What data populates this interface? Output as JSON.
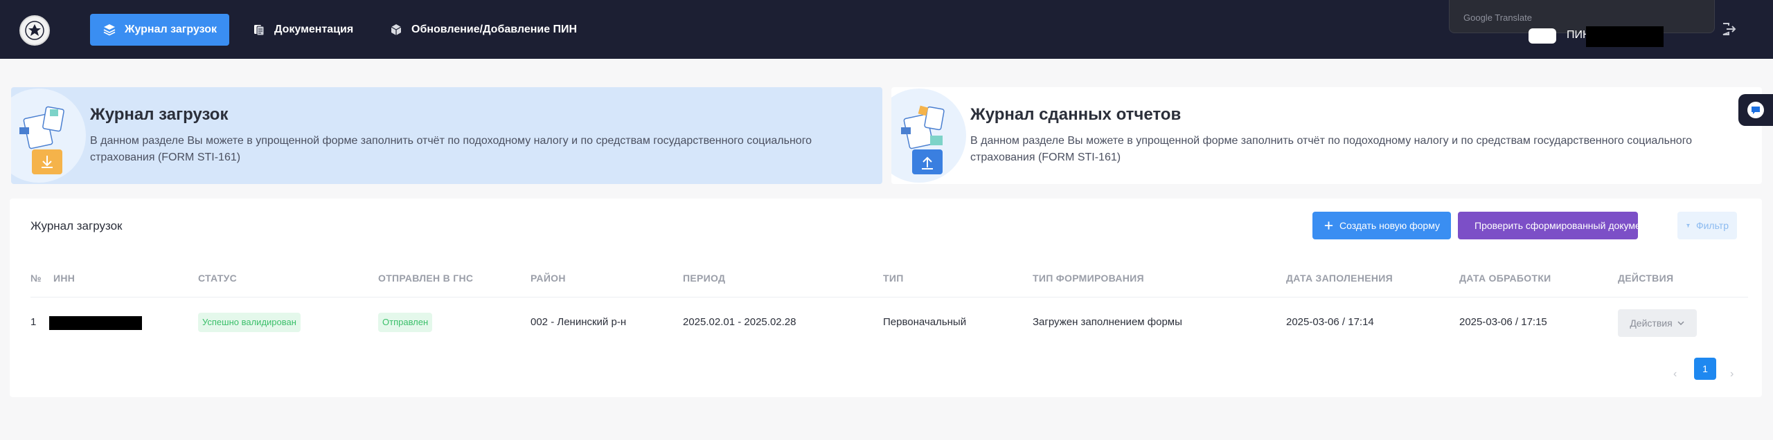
{
  "header": {
    "logo_alt": "state-emblem",
    "nav": [
      {
        "label": "Журнал загрузок",
        "icon": "layers-icon",
        "active": true
      },
      {
        "label": "Документация",
        "icon": "documents-icon",
        "active": false
      },
      {
        "label": "Обновление/Добавление ПИН",
        "icon": "cube-icon",
        "active": false
      }
    ],
    "translate_popup": "Google Translate",
    "pin_label": "ПИН:"
  },
  "hero_cards": [
    {
      "title": "Журнал загрузок",
      "text": "В данном разделе Вы можете в упрощенной форме заполнить отчёт по подоходному налогу и по средствам государственного социального страхования (FORM STI-161)",
      "icon": "download-folder-icon"
    },
    {
      "title": "Журнал сданных отчетов",
      "text": "В данном разделе Вы можете в упрощенной форме заполнить отчёт по подоходному налогу и по средствам государственного социального страхования (FORM STI-161)",
      "icon": "upload-folder-icon"
    }
  ],
  "panel": {
    "title": "Журнал загрузок",
    "buttons": {
      "create": "Создать новую форму",
      "check": "Проверить сформированный документ",
      "filter": "Фильтр"
    },
    "columns": [
      "№",
      "ИНН",
      "СТАТУС",
      "ОТПРАВЛЕН В ГНС",
      "РАЙОН",
      "ПЕРИОД",
      "ТИП",
      "ТИП ФОРМИРОВАНИЯ",
      "ДАТА ЗАПОЛЕНЕНИЯ",
      "ДАТА ОБРАБОТКИ",
      "ДЕЙСТВИЯ"
    ],
    "rows": [
      {
        "num": "1",
        "status": "Успешно валидирован",
        "sent": "Отправлен",
        "district": "002 - Ленинский р-н",
        "period": "2025.02.01 - 2025.02.28",
        "type": "Первоначальный",
        "formation": "Загружен заполнением формы",
        "filled_date": "2025-03-06 / 17:14",
        "processed_date": "2025-03-06 / 17:15",
        "actions": "Действия"
      }
    ],
    "pagination": {
      "prev": "‹",
      "current": "1",
      "next": "›"
    }
  },
  "colors": {
    "header_bg": "#1c1f33",
    "accent": "#3a8ef2",
    "purple": "#7c4fc7",
    "success": "#3bbf6a"
  }
}
